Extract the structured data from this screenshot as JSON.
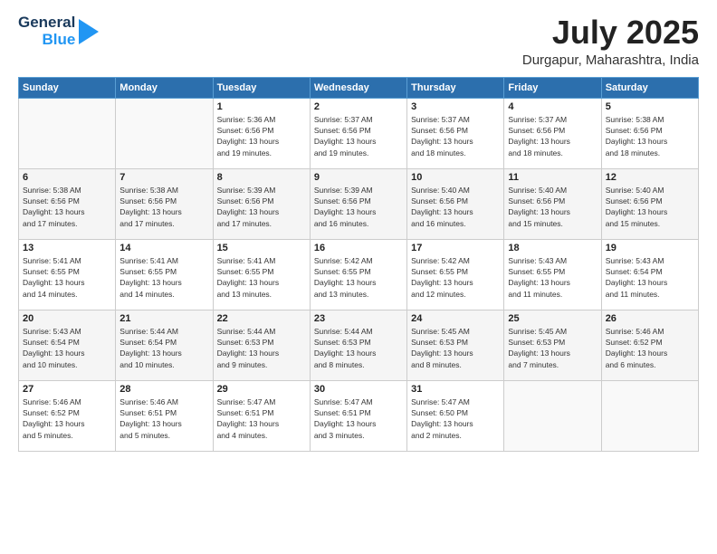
{
  "logo": {
    "line1": "General",
    "line2": "Blue"
  },
  "header": {
    "month": "July 2025",
    "location": "Durgapur, Maharashtra, India"
  },
  "weekdays": [
    "Sunday",
    "Monday",
    "Tuesday",
    "Wednesday",
    "Thursday",
    "Friday",
    "Saturday"
  ],
  "weeks": [
    [
      {
        "day": "",
        "info": ""
      },
      {
        "day": "",
        "info": ""
      },
      {
        "day": "1",
        "info": "Sunrise: 5:36 AM\nSunset: 6:56 PM\nDaylight: 13 hours\nand 19 minutes."
      },
      {
        "day": "2",
        "info": "Sunrise: 5:37 AM\nSunset: 6:56 PM\nDaylight: 13 hours\nand 19 minutes."
      },
      {
        "day": "3",
        "info": "Sunrise: 5:37 AM\nSunset: 6:56 PM\nDaylight: 13 hours\nand 18 minutes."
      },
      {
        "day": "4",
        "info": "Sunrise: 5:37 AM\nSunset: 6:56 PM\nDaylight: 13 hours\nand 18 minutes."
      },
      {
        "day": "5",
        "info": "Sunrise: 5:38 AM\nSunset: 6:56 PM\nDaylight: 13 hours\nand 18 minutes."
      }
    ],
    [
      {
        "day": "6",
        "info": "Sunrise: 5:38 AM\nSunset: 6:56 PM\nDaylight: 13 hours\nand 17 minutes."
      },
      {
        "day": "7",
        "info": "Sunrise: 5:38 AM\nSunset: 6:56 PM\nDaylight: 13 hours\nand 17 minutes."
      },
      {
        "day": "8",
        "info": "Sunrise: 5:39 AM\nSunset: 6:56 PM\nDaylight: 13 hours\nand 17 minutes."
      },
      {
        "day": "9",
        "info": "Sunrise: 5:39 AM\nSunset: 6:56 PM\nDaylight: 13 hours\nand 16 minutes."
      },
      {
        "day": "10",
        "info": "Sunrise: 5:40 AM\nSunset: 6:56 PM\nDaylight: 13 hours\nand 16 minutes."
      },
      {
        "day": "11",
        "info": "Sunrise: 5:40 AM\nSunset: 6:56 PM\nDaylight: 13 hours\nand 15 minutes."
      },
      {
        "day": "12",
        "info": "Sunrise: 5:40 AM\nSunset: 6:56 PM\nDaylight: 13 hours\nand 15 minutes."
      }
    ],
    [
      {
        "day": "13",
        "info": "Sunrise: 5:41 AM\nSunset: 6:55 PM\nDaylight: 13 hours\nand 14 minutes."
      },
      {
        "day": "14",
        "info": "Sunrise: 5:41 AM\nSunset: 6:55 PM\nDaylight: 13 hours\nand 14 minutes."
      },
      {
        "day": "15",
        "info": "Sunrise: 5:41 AM\nSunset: 6:55 PM\nDaylight: 13 hours\nand 13 minutes."
      },
      {
        "day": "16",
        "info": "Sunrise: 5:42 AM\nSunset: 6:55 PM\nDaylight: 13 hours\nand 13 minutes."
      },
      {
        "day": "17",
        "info": "Sunrise: 5:42 AM\nSunset: 6:55 PM\nDaylight: 13 hours\nand 12 minutes."
      },
      {
        "day": "18",
        "info": "Sunrise: 5:43 AM\nSunset: 6:55 PM\nDaylight: 13 hours\nand 11 minutes."
      },
      {
        "day": "19",
        "info": "Sunrise: 5:43 AM\nSunset: 6:54 PM\nDaylight: 13 hours\nand 11 minutes."
      }
    ],
    [
      {
        "day": "20",
        "info": "Sunrise: 5:43 AM\nSunset: 6:54 PM\nDaylight: 13 hours\nand 10 minutes."
      },
      {
        "day": "21",
        "info": "Sunrise: 5:44 AM\nSunset: 6:54 PM\nDaylight: 13 hours\nand 10 minutes."
      },
      {
        "day": "22",
        "info": "Sunrise: 5:44 AM\nSunset: 6:53 PM\nDaylight: 13 hours\nand 9 minutes."
      },
      {
        "day": "23",
        "info": "Sunrise: 5:44 AM\nSunset: 6:53 PM\nDaylight: 13 hours\nand 8 minutes."
      },
      {
        "day": "24",
        "info": "Sunrise: 5:45 AM\nSunset: 6:53 PM\nDaylight: 13 hours\nand 8 minutes."
      },
      {
        "day": "25",
        "info": "Sunrise: 5:45 AM\nSunset: 6:53 PM\nDaylight: 13 hours\nand 7 minutes."
      },
      {
        "day": "26",
        "info": "Sunrise: 5:46 AM\nSunset: 6:52 PM\nDaylight: 13 hours\nand 6 minutes."
      }
    ],
    [
      {
        "day": "27",
        "info": "Sunrise: 5:46 AM\nSunset: 6:52 PM\nDaylight: 13 hours\nand 5 minutes."
      },
      {
        "day": "28",
        "info": "Sunrise: 5:46 AM\nSunset: 6:51 PM\nDaylight: 13 hours\nand 5 minutes."
      },
      {
        "day": "29",
        "info": "Sunrise: 5:47 AM\nSunset: 6:51 PM\nDaylight: 13 hours\nand 4 minutes."
      },
      {
        "day": "30",
        "info": "Sunrise: 5:47 AM\nSunset: 6:51 PM\nDaylight: 13 hours\nand 3 minutes."
      },
      {
        "day": "31",
        "info": "Sunrise: 5:47 AM\nSunset: 6:50 PM\nDaylight: 13 hours\nand 2 minutes."
      },
      {
        "day": "",
        "info": ""
      },
      {
        "day": "",
        "info": ""
      }
    ]
  ]
}
